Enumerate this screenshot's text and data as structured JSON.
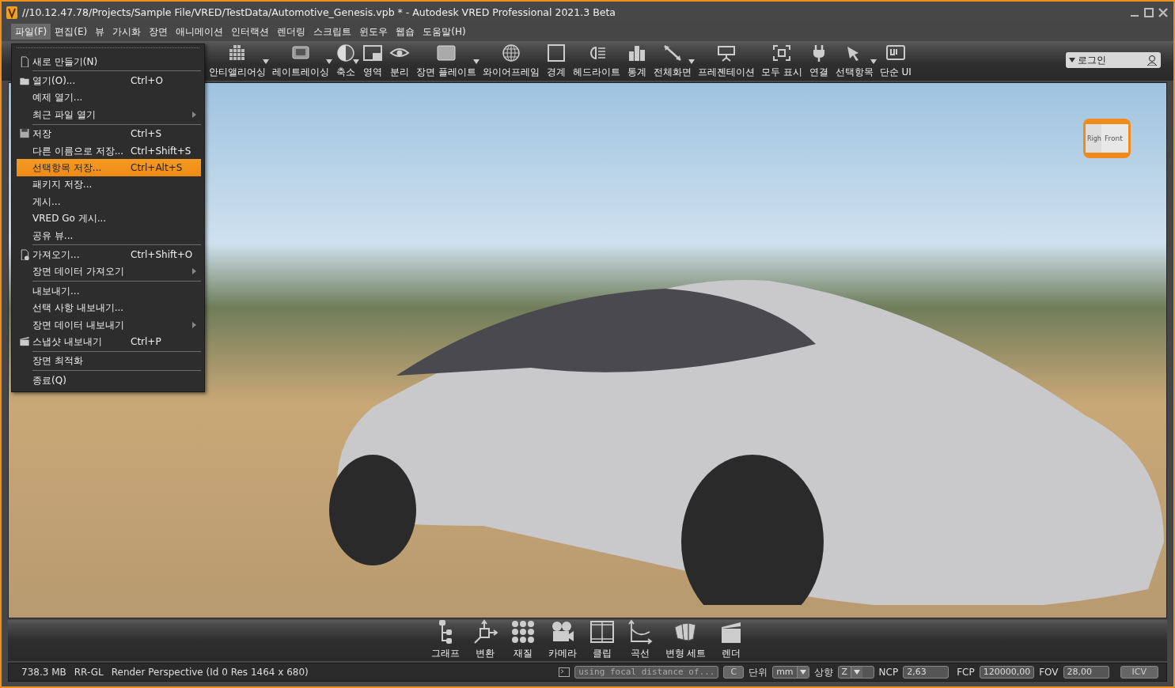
{
  "window": {
    "title": "//10.12.47.78/Projects/Sample File/VRED/TestData/Automotive_Genesis.vpb * - Autodesk VRED Professional 2021.3 Beta"
  },
  "menubar": [
    {
      "label": "파일(F)",
      "selected": true
    },
    {
      "label": "편집(E)",
      "selected": false
    },
    {
      "label": "뷰",
      "selected": false
    },
    {
      "label": "가시화",
      "selected": false
    },
    {
      "label": "장면",
      "selected": false
    },
    {
      "label": "애니메이션",
      "selected": false
    },
    {
      "label": "인터랙션",
      "selected": false
    },
    {
      "label": "렌더링",
      "selected": false
    },
    {
      "label": "스크립트",
      "selected": false
    },
    {
      "label": "윈도우",
      "selected": false
    },
    {
      "label": "웹숍",
      "selected": false
    },
    {
      "label": "도움말(H)",
      "selected": false
    }
  ],
  "file_menu": [
    {
      "label": "새로 만들기(N)",
      "separator_after": true,
      "selected": false
    },
    {
      "label": "열기(O)...",
      "shortcut": "Ctrl+O",
      "selected": false
    },
    {
      "label": "예제 열기...",
      "selected": false
    },
    {
      "label": "최근 파일 열기",
      "submenu": true,
      "separator_after": true,
      "selected": false
    },
    {
      "label": "저장",
      "shortcut": "Ctrl+S",
      "selected": false
    },
    {
      "label": "다른 이름으로 저장...",
      "shortcut": "Ctrl+Shift+S",
      "selected": false
    },
    {
      "label": "선택항목 저장...",
      "shortcut": "Ctrl+Alt+S",
      "selected": true
    },
    {
      "label": "패키지 저장...",
      "selected": false
    },
    {
      "label": "게시...",
      "selected": false
    },
    {
      "label": "VRED Go 게시...",
      "selected": false
    },
    {
      "label": "공유 뷰...",
      "separator_after": true,
      "selected": false
    },
    {
      "label": "가져오기...",
      "shortcut": "Ctrl+Shift+O",
      "selected": false
    },
    {
      "label": "장면 데이터 가져오기",
      "submenu": true,
      "separator_after": true,
      "selected": false
    },
    {
      "label": "내보내기...",
      "selected": false
    },
    {
      "label": "선택 사항 내보내기...",
      "selected": false
    },
    {
      "label": "장면 데이터 내보내기",
      "submenu": true,
      "selected": false
    },
    {
      "label": "스냅샷 내보내기",
      "shortcut": "Ctrl+P",
      "separator_after": true,
      "selected": false
    },
    {
      "label": "장면 최적화",
      "separator_after": true,
      "selected": false
    },
    {
      "label": "종료(Q)",
      "selected": false
    }
  ],
  "toolbar": [
    {
      "label": "안티앨리어싱",
      "dropdown": true
    },
    {
      "label": "레이트레이싱",
      "dropdown": true
    },
    {
      "label": "축소",
      "dropdown": true
    },
    {
      "label": "영역",
      "dropdown": false
    },
    {
      "label": "분리",
      "dropdown": false
    },
    {
      "label": "장면 플레이트",
      "dropdown": true
    },
    {
      "label": "와이어프레임",
      "dropdown": false
    },
    {
      "label": "경계",
      "dropdown": false
    },
    {
      "label": "헤드라이트",
      "dropdown": false
    },
    {
      "label": "통계",
      "dropdown": false
    },
    {
      "label": "전체화면",
      "dropdown": true
    },
    {
      "label": "프레젠테이션",
      "dropdown": false
    },
    {
      "label": "모두 표시",
      "dropdown": false
    },
    {
      "label": "연결",
      "dropdown": false
    },
    {
      "label": "선택항목",
      "dropdown": true
    },
    {
      "label": "단순 UI",
      "dropdown": false
    }
  ],
  "login": {
    "label": "로그인"
  },
  "view_cube": {
    "left_face": "Righ",
    "front_face": "Front"
  },
  "dock": [
    {
      "label": "그래프"
    },
    {
      "label": "변환"
    },
    {
      "label": "재질"
    },
    {
      "label": "카메라"
    },
    {
      "label": "클립"
    },
    {
      "label": "곡선"
    },
    {
      "label": "변형 세트"
    },
    {
      "label": "렌더"
    }
  ],
  "status_bar": {
    "memory": "738.3 MB",
    "renderer": "RR-GL",
    "render_info": "Render Perspective (Id 0 Res 1464 x 680)",
    "console_field": "using focal distance of...",
    "clear_button": "C",
    "unit_label": "단위",
    "unit_value": "mm",
    "up_label": "상향",
    "up_value": "Z",
    "ncp_label": "NCP",
    "ncp_value": "2,63",
    "fcp_label": "FCP",
    "fcp_value": "120000,00",
    "fov_label": "FOV",
    "fov_value": "28,00",
    "icv_button": "ICV"
  }
}
